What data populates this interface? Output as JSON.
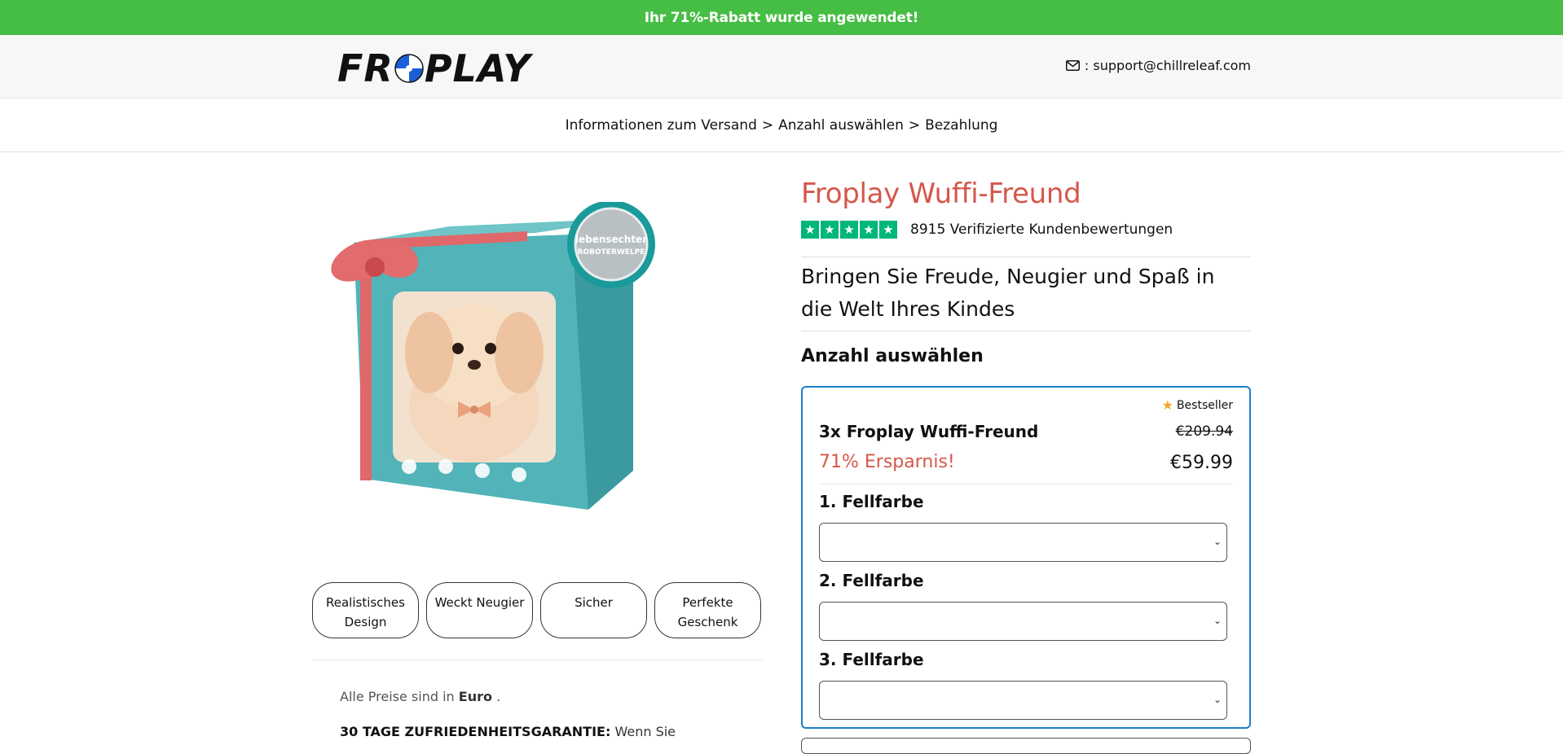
{
  "promo": {
    "text": "Ihr 71%-Rabatt wurde angewendet!"
  },
  "header": {
    "logo_prefix": "FR",
    "logo_suffix": "PLAY",
    "support_text": ": support@chillreleaf.com"
  },
  "breadcrumb": {
    "step1": "Informationen zum Versand",
    "sep1": ">",
    "step2": "Anzahl auswählen",
    "sep2": ">",
    "step3": "Bezahlung"
  },
  "product": {
    "image_badge_line1": "lebensechter",
    "image_badge_line2": "ROBOTERWELPE",
    "title": "Froplay Wuffi-Freund",
    "rating_stars": 5,
    "reviews": "8915 Verifizierte Kundenbewertungen",
    "tagline": "Bringen Sie Freude, Neugier und Spaß in die Welt Ihres Kindes"
  },
  "features": [
    {
      "label": "Realistisches Design"
    },
    {
      "label": "Weckt Neugier"
    },
    {
      "label": "Sicher"
    },
    {
      "label": "Perfekte Geschenk"
    }
  ],
  "info": {
    "prices_prefix": "Alle Preise sind in",
    "prices_currency": "Euro",
    "prices_suffix": ".",
    "guarantee_bold": "30 TAGE ZUFRIEDENHEITSGARANTIE:",
    "guarantee_text": "Wenn Sie"
  },
  "quantity": {
    "heading": "Anzahl auswählen",
    "offer": {
      "badge": "Bestseller",
      "name": "3x Froplay Wuffi-Freund",
      "old_price": "€209.94",
      "saving": "71% Ersparnis!",
      "price": "€59.99",
      "fur_colors": [
        {
          "label": "1. Fellfarbe",
          "value": ""
        },
        {
          "label": "2. Fellfarbe",
          "value": ""
        },
        {
          "label": "3. Fellfarbe",
          "value": ""
        }
      ]
    }
  },
  "colors": {
    "promo_green": "#46bd44",
    "title_red": "#d5574b",
    "trustpilot_green": "#00b67a",
    "card_border_blue": "#1b7fc9",
    "badge_star_orange": "#f5a623"
  }
}
